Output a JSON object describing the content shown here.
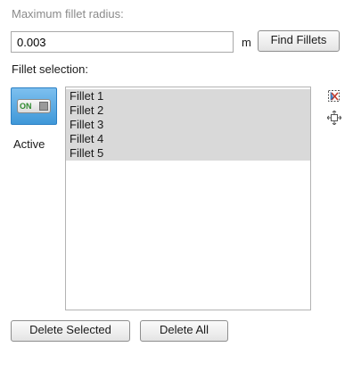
{
  "radius": {
    "label": "Maximum fillet radius:",
    "value": "0.003",
    "unit": "m",
    "find_button": "Find Fillets"
  },
  "selection": {
    "label": "Fillet selection:",
    "toggle_text": "ON",
    "active_label": "Active",
    "items": [
      {
        "label": "Fillet 1"
      },
      {
        "label": "Fillet 2"
      },
      {
        "label": "Fillet 3"
      },
      {
        "label": "Fillet 4"
      },
      {
        "label": "Fillet 5"
      }
    ],
    "side_icons": [
      "clear-selection-icon",
      "zoom-to-selection-icon"
    ]
  },
  "actions": {
    "delete_selected": "Delete Selected",
    "delete_all": "Delete All"
  }
}
